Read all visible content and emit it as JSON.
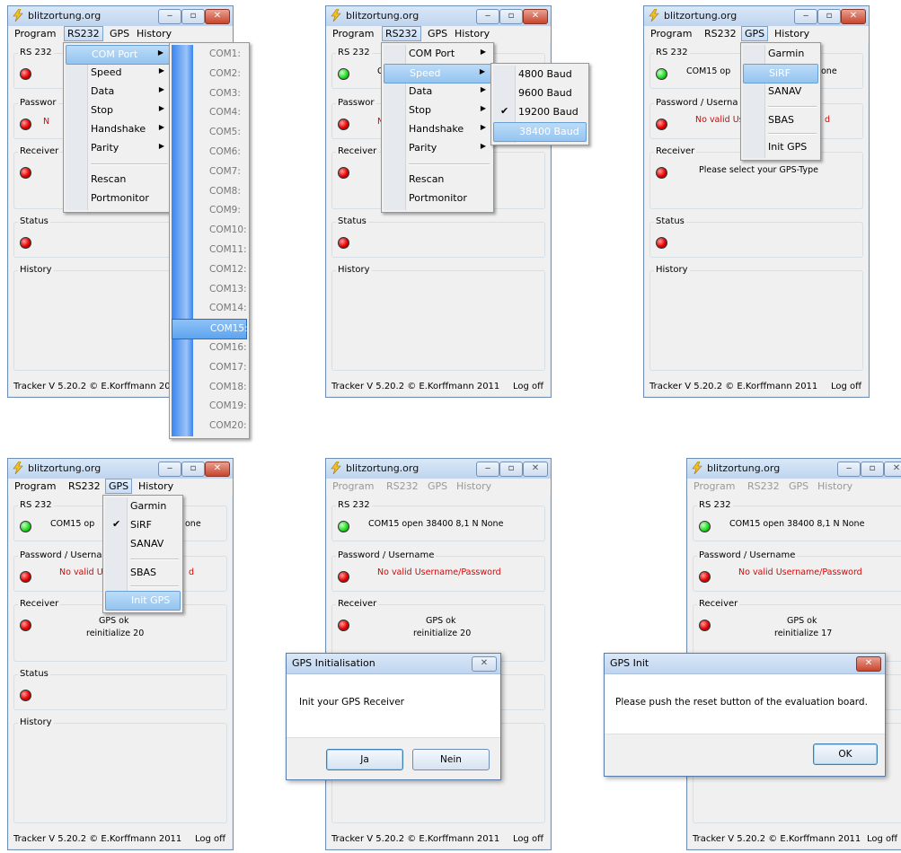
{
  "app": {
    "title": "blitzortung.org",
    "menu": [
      "Program",
      "RS232",
      "GPS",
      "History"
    ],
    "footer": "Tracker V 5.20.2 © E.Korffmann 2011",
    "logoff": "Log off"
  },
  "groups": {
    "rs232": "RS 232",
    "password": "Password / Username",
    "receiver": "Receiver",
    "status": "Status",
    "history": "History"
  },
  "panel1": {
    "menu_rs232": [
      "COM Port",
      "Speed",
      "Data",
      "Stop",
      "Handshake",
      "Parity",
      "Rescan",
      "Portmonitor"
    ],
    "com_ports": [
      "COM1:",
      "COM2:",
      "COM3:",
      "COM4:",
      "COM5:",
      "COM6:",
      "COM7:",
      "COM8:",
      "COM9:",
      "COM10:",
      "COM11:",
      "COM12:",
      "COM13:",
      "COM14:",
      "COM15:",
      "COM16:",
      "COM17:",
      "COM18:",
      "COM19:",
      "COM20:"
    ],
    "rs232_text": "",
    "pw_text": "N",
    "pw_label_short": "Passwor"
  },
  "panel2": {
    "menu_rs232": [
      "COM Port",
      "Speed",
      "Data",
      "Stop",
      "Handshake",
      "Parity",
      "Rescan",
      "Portmonitor"
    ],
    "speeds": [
      "4800 Baud",
      "9600 Baud",
      "19200 Baud",
      "38400 Baud"
    ],
    "rs232_text": "C",
    "pw_text": "N",
    "pw_label_short": "Passwor"
  },
  "panel3": {
    "gps_menu": [
      "Garmin",
      "SiRF",
      "SANAV",
      "SBAS",
      "Init GPS"
    ],
    "rs232_text_a": "COM15 op",
    "rs232_text_b": "one",
    "pw_label_short": "Password / Userna",
    "pw_text": "No valid Us",
    "pw_text_b": "d",
    "receiver_text": "Please select your GPS-Type"
  },
  "panel4": {
    "gps_menu": [
      "Garmin",
      "SiRF",
      "SANAV",
      "SBAS",
      "Init GPS"
    ],
    "rs232_text_a": "COM15 op",
    "rs232_text_b": "one",
    "pw_label_short": "Password / Userna",
    "pw_text": "No valid Us",
    "pw_text_b": "d",
    "receiver_line1": "GPS ok",
    "receiver_line2": "reinitialize 20"
  },
  "panel5": {
    "rs232_text": "COM15 open  38400 8,1 N None",
    "pw_text": "No valid Username/Password",
    "receiver_line1": "GPS ok",
    "receiver_line2": "reinitialize 20",
    "dialog": {
      "title": "GPS Initialisation",
      "message": "Init your GPS Receiver",
      "yes": "Ja",
      "no": "Nein"
    }
  },
  "panel6": {
    "rs232_text": "COM15 open  38400 8,1 N None",
    "pw_text": "No valid Username/Password",
    "receiver_line1": "GPS ok",
    "receiver_line2": "reinitialize 17",
    "dialog": {
      "title": "GPS Init",
      "message": "Please push the reset button of the evaluation board.",
      "ok": "OK"
    },
    "footer_logoff": "Log off"
  },
  "colors": {
    "led_red": "#e60000",
    "led_green": "#22dd22",
    "error_text": "#e00000",
    "highlight": "#94c4f0"
  }
}
